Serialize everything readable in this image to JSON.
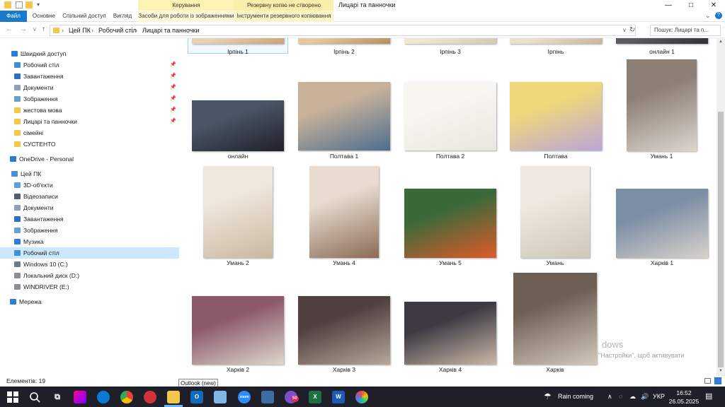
{
  "window": {
    "title": "Лицарі та панночки",
    "ctx_manage": "Керування",
    "ctx_backup": "Резервну копію не створено",
    "minimize": "—",
    "maximize": "□",
    "close": "✕"
  },
  "ribbon": {
    "tabs": [
      "Файл",
      "Основне",
      "Спільний доступ",
      "Вигляд",
      "Засоби для роботи із зображеннями",
      "Інструменти резервного копіювання"
    ]
  },
  "address": {
    "back": "←",
    "forward": "→",
    "recent": "∨",
    "up": "↑",
    "crumbs": [
      "Цей ПК",
      "Робочий стіл",
      "Лицарі та панночки"
    ],
    "separator": "›",
    "search_placeholder": "Пошук: Лицарі та п..."
  },
  "sidebar": {
    "items": [
      {
        "label": "Швидкий доступ",
        "icon": "star-icon",
        "color": "#2d7fd3"
      },
      {
        "label": "Робочий стіл",
        "icon": "desktop-icon",
        "color": "#3c8fd8",
        "pinned": true
      },
      {
        "label": "Завантаження",
        "icon": "download-icon",
        "color": "#2d6fc0",
        "pinned": true
      },
      {
        "label": "Документи",
        "icon": "document-icon",
        "color": "#8aa1b8",
        "pinned": true
      },
      {
        "label": "Зображення",
        "icon": "picture-icon",
        "color": "#6c9fd1",
        "pinned": true
      },
      {
        "label": "жестова мова",
        "icon": "folder-icon",
        "color": "#f3c84a",
        "pinned": true
      },
      {
        "label": "Лицарі та панночки",
        "icon": "folder-icon",
        "color": "#f3c84a",
        "pinned": true
      },
      {
        "label": "сімейні",
        "icon": "folder-icon",
        "color": "#f3c84a"
      },
      {
        "label": "СУСТЕНТО",
        "icon": "folder-icon",
        "color": "#f3c84a"
      },
      {
        "label": "OneDrive - Personal",
        "icon": "cloud-icon",
        "color": "#2a7ad5"
      },
      {
        "label": "Цей ПК",
        "icon": "computer-icon",
        "color": "#4a90d9"
      },
      {
        "label": "3D-об'єкти",
        "icon": "cube-icon",
        "color": "#5da0dc"
      },
      {
        "label": "Відеозаписи",
        "icon": "video-icon",
        "color": "#555c6b"
      },
      {
        "label": "Документи",
        "icon": "document-icon",
        "color": "#8aa1b8"
      },
      {
        "label": "Завантаження",
        "icon": "download-icon",
        "color": "#2d6fc0"
      },
      {
        "label": "Зображення",
        "icon": "picture-icon",
        "color": "#6c9fd1"
      },
      {
        "label": "Музика",
        "icon": "music-icon",
        "color": "#2d7fd3"
      },
      {
        "label": "Робочий стіл",
        "icon": "desktop-icon",
        "color": "#3c8fd8",
        "selected": true
      },
      {
        "label": "Windows 10 (C:)",
        "icon": "drive-icon",
        "color": "#6d7c8a"
      },
      {
        "label": "Локальний диск (D:)",
        "icon": "drive-icon",
        "color": "#8a8f96"
      },
      {
        "label": "WINDRIVER (E:)",
        "icon": "drive-icon",
        "color": "#8a8f96"
      },
      {
        "label": "Мережа",
        "icon": "network-icon",
        "color": "#2d7fd3"
      }
    ],
    "pin_glyph": "📌"
  },
  "files": [
    {
      "name": "Ірпінь 1",
      "selected": true
    },
    {
      "name": "Ірпінь 2"
    },
    {
      "name": "Ірпінь 3"
    },
    {
      "name": "Ірпінь"
    },
    {
      "name": "онлайн 1"
    },
    {
      "name": "онлайн"
    },
    {
      "name": "Полтава 1"
    },
    {
      "name": "Полтава 2"
    },
    {
      "name": "Полтава"
    },
    {
      "name": "Умань 1"
    },
    {
      "name": "Умань 2"
    },
    {
      "name": "Умань 4"
    },
    {
      "name": "Умань 5"
    },
    {
      "name": "Умань"
    },
    {
      "name": "Харків 1"
    },
    {
      "name": "Харків 2"
    },
    {
      "name": "Харків 3"
    },
    {
      "name": "Харків 4"
    },
    {
      "name": "Харків"
    }
  ],
  "status": {
    "items_count": "Елементів: 19"
  },
  "tooltip": "Outlook (new)",
  "watermark": {
    "line1": "dows",
    "line2": "\"Настройки\", щоб активувати"
  },
  "taskbar": {
    "weather": "Rain coming",
    "lang": "УКР",
    "time": "16:52",
    "date": "26.05.2025",
    "badge": "50",
    "zoom_label": "zoom"
  },
  "colors": {
    "accent": "#1979ca",
    "selection": "#cce8ff",
    "ribbon_context": "#fdf3b5",
    "taskbar": "#1f1f29"
  }
}
